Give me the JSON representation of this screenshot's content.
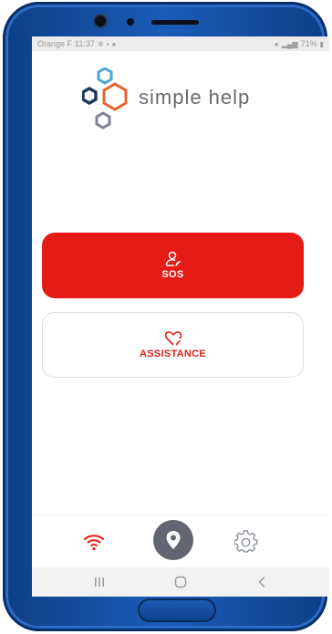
{
  "status_bar": {
    "carrier": "Orange F",
    "time": "11:37",
    "battery": "71%"
  },
  "app": {
    "logo_text": "simple help"
  },
  "buttons": {
    "sos_label": "SOS",
    "assistance_label": "ASSISTANCE"
  },
  "bottom_nav": {
    "left_icon": "wifi-icon",
    "center_icon": "location-pin-icon",
    "right_icon": "gear-icon"
  },
  "colors": {
    "accent_red": "#e41c15",
    "logo_blue": "#4aa6d8",
    "logo_orange": "#e8632b",
    "logo_navy": "#1f3b5c",
    "logo_gray": "#7f8392",
    "nav_gray": "#626670"
  }
}
